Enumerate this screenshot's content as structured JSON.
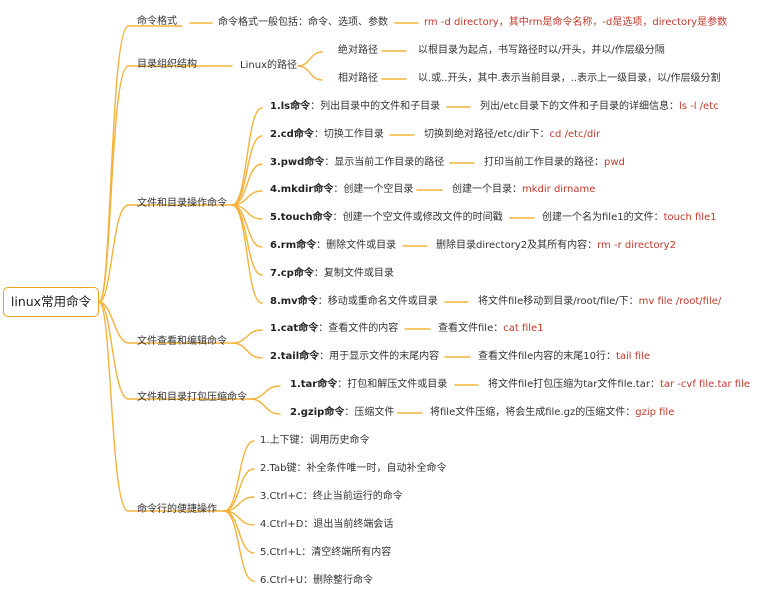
{
  "root": "linux常用命令",
  "categories": [
    {
      "label": "命令格式",
      "desc": "命令格式一般包括：命令、选项、参数",
      "example": "rm -d directory，其中rm是命令名称，-d是选项，directory是参数"
    },
    {
      "label": "目录组织结构",
      "sub": "Linux的路径",
      "paths": [
        {
          "name": "绝对路径",
          "desc": "以根目录为起点，书写路径时以/开头，并以/作层级分隔"
        },
        {
          "name": "相对路径",
          "desc": "以.或..开头，其中.表示当前目录，..表示上一级目录，以/作层级分割"
        }
      ]
    },
    {
      "label": "文件和目录操作命令",
      "items": [
        {
          "cmd": "1.ls命令",
          "desc": "：列出目录中的文件和子目录",
          "example": "列出/etc目录下的文件和子目录的详细信息：",
          "code": "ls -l /etc"
        },
        {
          "cmd": "2.cd命令",
          "desc": "：切换工作目录",
          "example": "切换到绝对路径/etc/dir下：",
          "code": "cd /etc/dir"
        },
        {
          "cmd": "3.pwd命令",
          "desc": "：显示当前工作目录的路径",
          "example": "打印当前工作目录的路径：",
          "code": "pwd"
        },
        {
          "cmd": "4.mkdir命令",
          "desc": "：创建一个空目录",
          "example": "创建一个目录：",
          "code": "mkdir dirname"
        },
        {
          "cmd": "5.touch命令",
          "desc": "：创建一个空文件或修改文件的时间戳",
          "example": "创建一个名为file1的文件：",
          "code": "touch file1"
        },
        {
          "cmd": "6.rm命令",
          "desc": "：删除文件或目录",
          "example": "删除目录directory2及其所有内容：",
          "code": "rm -r directory2"
        },
        {
          "cmd": "7.cp命令",
          "desc": "：复制文件或目录",
          "example": "",
          "code": ""
        },
        {
          "cmd": "8.mv命令",
          "desc": "：移动或重命名文件或目录",
          "example": "将文件file移动到目录/root/file/下：",
          "code": "mv file /root/file/"
        }
      ]
    },
    {
      "label": "文件查看和编辑命令",
      "items": [
        {
          "cmd": "1.cat命令",
          "desc": "：查看文件的内容",
          "example": "查看文件file：",
          "code": "cat file1"
        },
        {
          "cmd": "2.tail命令",
          "desc": "：用于显示文件的末尾内容",
          "example": "查看文件file内容的末尾10行：",
          "code": "tail file"
        }
      ]
    },
    {
      "label": "文件和目录打包压缩命令",
      "items": [
        {
          "cmd": "1.tar命令",
          "desc": "：打包和解压文件或目录",
          "example": "将文件file打包压缩为tar文件file.tar：",
          "code": "tar -cvf file.tar file"
        },
        {
          "cmd": "2.gzip命令",
          "desc": "：压缩文件",
          "example": "将file文件压缩，将会生成file.gz的压缩文件：",
          "code": "gzip file"
        }
      ]
    },
    {
      "label": "命令行的便捷操作",
      "items": [
        {
          "text": "1.上下键：调用历史命令"
        },
        {
          "text": "2.Tab键：补全条件唯一时，自动补全命令"
        },
        {
          "text": "3.Ctrl+C：终止当前运行的命令"
        },
        {
          "text": "4.Ctrl+D：退出当前终端会话"
        },
        {
          "text": "5.Ctrl+L：清空终端所有内容"
        },
        {
          "text": "6.Ctrl+U：删除整行命令"
        }
      ]
    }
  ],
  "colors": {
    "root_border": "#f0a020",
    "line": "#f3b23c",
    "code": "#c0392b"
  }
}
